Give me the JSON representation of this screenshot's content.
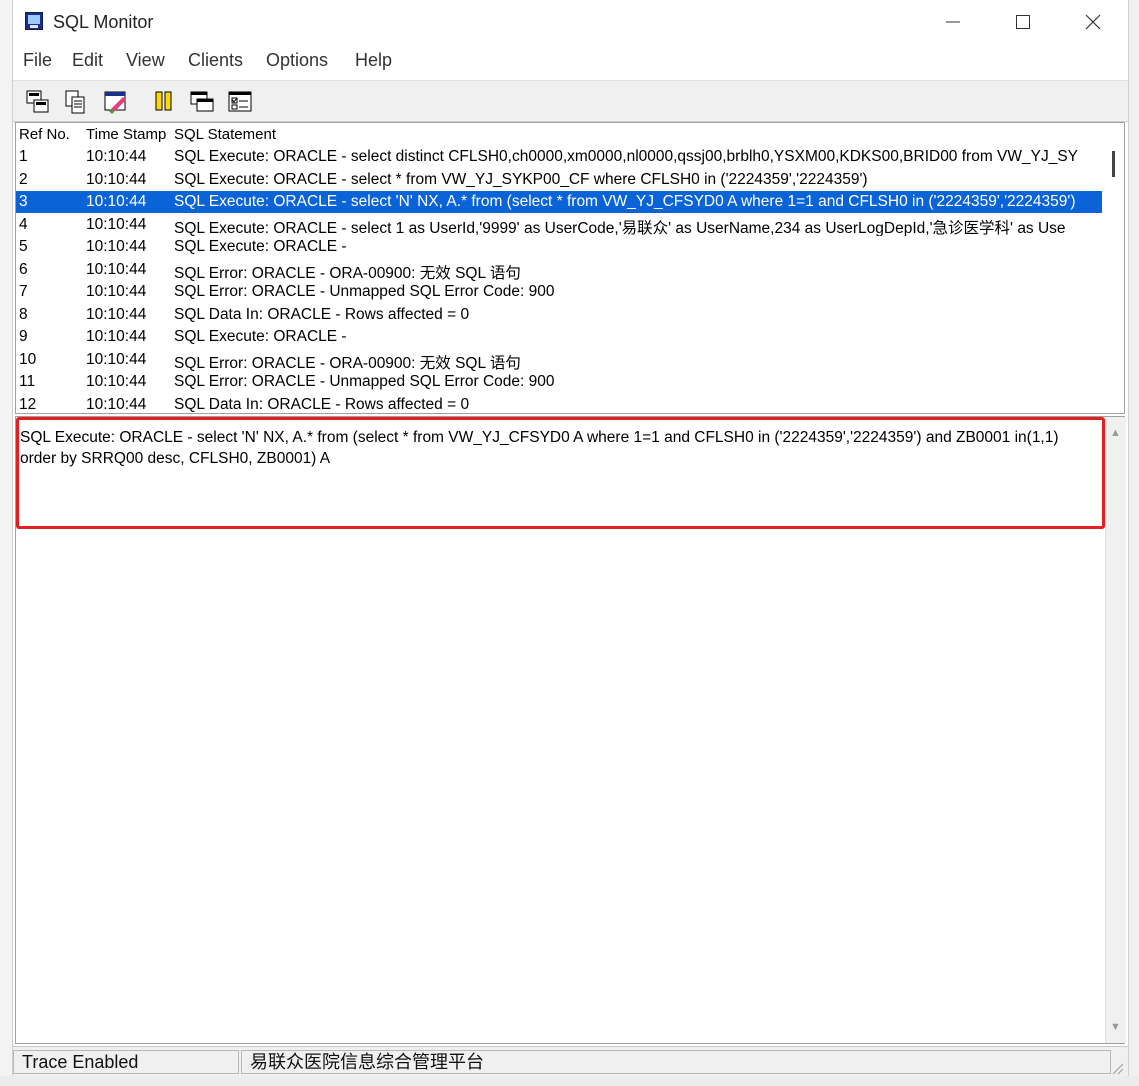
{
  "window": {
    "title": "SQL Monitor"
  },
  "menu": [
    "File",
    "Edit",
    "View",
    "Clients",
    "Options",
    "Help"
  ],
  "toolbar": {
    "icons": [
      "save-log-icon",
      "copy-icon",
      "clear-icon",
      "pause-icon",
      "window-icon",
      "options-icon"
    ]
  },
  "list": {
    "columns": [
      "Ref No.",
      "Time Stamp",
      "SQL Statement"
    ],
    "selected_index": 2,
    "rows": [
      {
        "ref": "1",
        "time": "10:10:44",
        "sql": "SQL Execute: ORACLE - select distinct CFLSH0,ch0000,xm0000,nl0000,qssj00,brblh0,YSXM00,KDKS00,BRID00 from VW_YJ_SY"
      },
      {
        "ref": "2",
        "time": "10:10:44",
        "sql": "SQL Execute: ORACLE - select * from VW_YJ_SYKP00_CF  where  CFLSH0 in ('2224359','2224359')"
      },
      {
        "ref": "3",
        "time": "10:10:44",
        "sql": "SQL Execute: ORACLE - select 'N' NX, A.* from (select * from VW_YJ_CFSYD0 A where 1=1 and CFLSH0 in ('2224359','2224359')"
      },
      {
        "ref": "4",
        "time": "10:10:44",
        "sql": "SQL Execute: ORACLE - select 1 as UserId,'9999' as UserCode,'易联众' as UserName,234 as UserLogDepId,'急诊医学科' as Use"
      },
      {
        "ref": "5",
        "time": "10:10:44",
        "sql": "SQL Execute: ORACLE -"
      },
      {
        "ref": "6",
        "time": "10:10:44",
        "sql": "SQL Error: ORACLE - ORA-00900: 无效 SQL 语句"
      },
      {
        "ref": "7",
        "time": "10:10:44",
        "sql": "SQL Error: ORACLE - Unmapped SQL Error Code: 900"
      },
      {
        "ref": "8",
        "time": "10:10:44",
        "sql": "SQL Data In: ORACLE - Rows affected = 0"
      },
      {
        "ref": "9",
        "time": "10:10:44",
        "sql": "SQL Execute: ORACLE -"
      },
      {
        "ref": "10",
        "time": "10:10:44",
        "sql": "SQL Error: ORACLE - ORA-00900: 无效 SQL 语句"
      },
      {
        "ref": "11",
        "time": "10:10:44",
        "sql": "SQL Error: ORACLE - Unmapped SQL Error Code: 900"
      },
      {
        "ref": "12",
        "time": "10:10:44",
        "sql": "SQL Data In: ORACLE - Rows affected = 0"
      }
    ]
  },
  "detail": {
    "text": "SQL Execute: ORACLE - select 'N' NX, A.* from (select * from VW_YJ_CFSYD0 A where 1=1 and CFLSH0 in ('2224359','2224359') and ZB0001 in(1,1)\norder by SRRQ00 desc, CFLSH0, ZB0001) A"
  },
  "status": {
    "trace": "Trace Enabled",
    "app": "易联众医院信息综合管理平台"
  },
  "colors": {
    "selection": "#0a64d8",
    "highlight_box": "#e22020"
  }
}
